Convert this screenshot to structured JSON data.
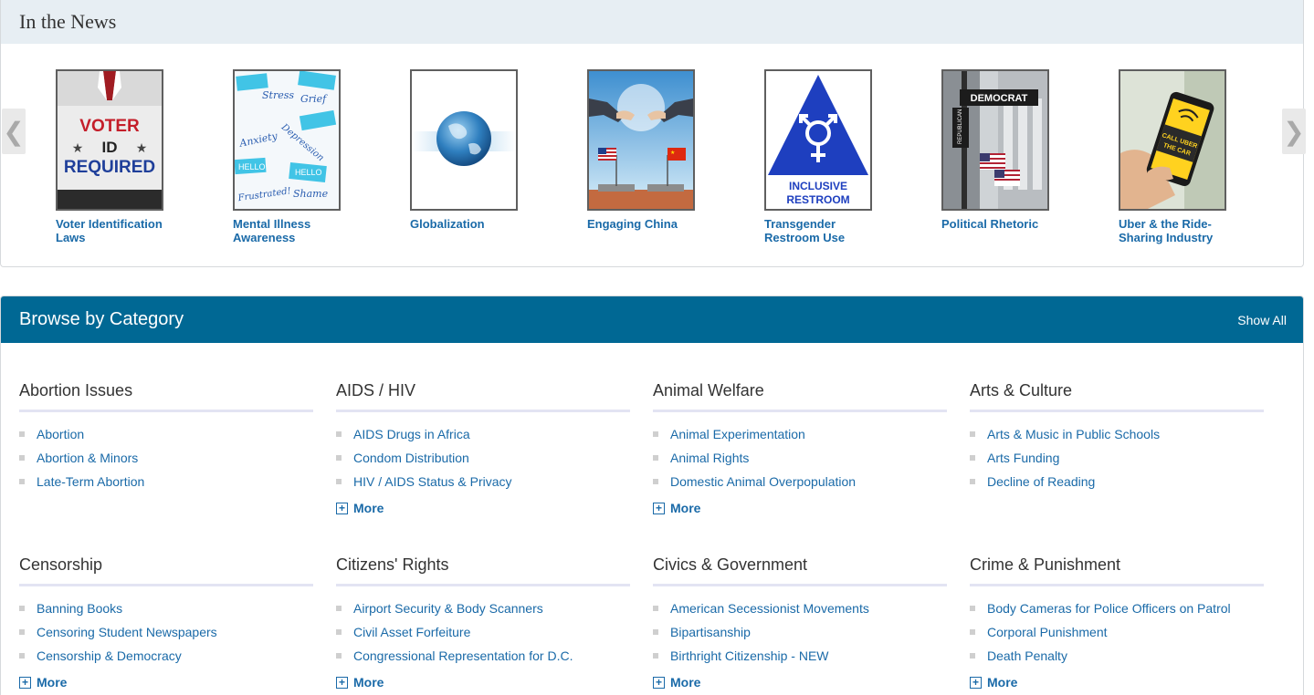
{
  "news": {
    "title": "In the News",
    "prev_arrow": "❮",
    "next_arrow": "❯",
    "items": [
      {
        "label": "Voter Identification Laws",
        "thumb_text": [
          "VOTER",
          "ID",
          "REQUIRED"
        ]
      },
      {
        "label": "Mental Illness Awareness",
        "thumb_text": [
          "Stress",
          "Grief",
          "Anxiety",
          "Depression",
          "HELLO",
          "HELLO",
          "Frustrated!",
          "Shame"
        ]
      },
      {
        "label": "Globalization"
      },
      {
        "label": "Engaging China"
      },
      {
        "label": "Transgender Restroom Use",
        "thumb_text": [
          "INCLUSIVE",
          "RESTROOM"
        ]
      },
      {
        "label": "Political Rhetoric",
        "thumb_text": [
          "DEMOCRAT",
          "REPUBLICAN"
        ]
      },
      {
        "label": "Uber & the Ride-Sharing Industry",
        "thumb_text": [
          "CALL UBER",
          "THE CAR"
        ]
      }
    ]
  },
  "browse": {
    "title": "Browse by Category",
    "show_all": "Show All",
    "more_label": "More",
    "categories": [
      {
        "title": "Abortion Issues",
        "links": [
          "Abortion",
          "Abortion & Minors",
          "Late-Term Abortion"
        ],
        "has_more": false
      },
      {
        "title": "AIDS / HIV",
        "links": [
          "AIDS Drugs in Africa",
          "Condom Distribution",
          "HIV / AIDS Status & Privacy"
        ],
        "has_more": true
      },
      {
        "title": "Animal Welfare",
        "links": [
          "Animal Experimentation",
          "Animal Rights",
          "Domestic Animal Overpopulation"
        ],
        "has_more": true
      },
      {
        "title": "Arts & Culture",
        "links": [
          "Arts & Music in Public Schools",
          "Arts Funding",
          "Decline of Reading"
        ],
        "has_more": false
      },
      {
        "title": "Censorship",
        "links": [
          "Banning Books",
          "Censoring Student Newspapers",
          "Censorship & Democracy"
        ],
        "has_more": true
      },
      {
        "title": "Citizens' Rights",
        "links": [
          "Airport Security & Body Scanners",
          "Civil Asset Forfeiture",
          "Congressional Representation for D.C."
        ],
        "has_more": true
      },
      {
        "title": "Civics & Government",
        "links": [
          "American Secessionist Movements",
          "Bipartisanship",
          "Birthright Citizenship - NEW"
        ],
        "has_more": true
      },
      {
        "title": "Crime & Punishment",
        "links": [
          "Body Cameras for Police Officers on Patrol",
          "Corporal Punishment",
          "Death Penalty"
        ],
        "has_more": true
      }
    ]
  },
  "colors": {
    "link": "#1a6aa8",
    "browse_header_bg": "#006894",
    "news_header_bg": "#e7eef3",
    "category_underline": "#e3e4f3"
  }
}
